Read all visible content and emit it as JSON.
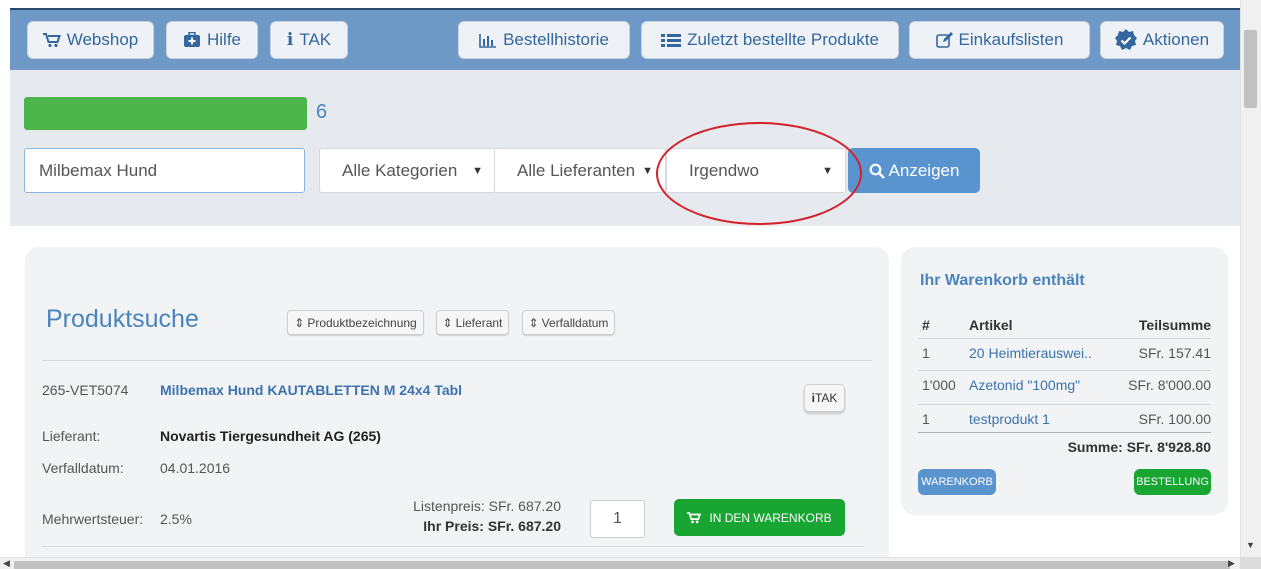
{
  "nav": {
    "webshop": "Webshop",
    "hilfe": "Hilfe",
    "tak": "TAK",
    "bestellhistorie": "Bestellhistorie",
    "zuletzt": "Zuletzt bestellte Produkte",
    "einkaufslisten": "Einkaufslisten",
    "aktionen": "Aktionen"
  },
  "progress": {
    "count": "6",
    "fill_fraction": 1.0,
    "color": "#4cb54c"
  },
  "search": {
    "query": "Milbemax Hund",
    "category": "Alle Kategorien",
    "supplier": "Alle Lieferanten",
    "location": "Irgendwo",
    "button": "Anzeigen"
  },
  "results": {
    "title": "Produktsuche",
    "sort": {
      "name": "Produktbezeichnung",
      "supplier": "Lieferant",
      "expiry": "Verfalldatum"
    },
    "product": {
      "code": "265-VET5074",
      "name": "Milbemax Hund KAUTABLETTEN M 24x4 Tabl",
      "tak": "TAK",
      "supplier_label": "Lieferant:",
      "supplier": "Novartis Tiergesundheit AG (265)",
      "expiry_label": "Verfalldatum:",
      "expiry": "04.01.2016",
      "vat_label": "Mehrwertsteuer:",
      "vat": "2.5%",
      "list_price": "Listenpreis: SFr. 687.20",
      "your_price": "Ihr Preis: SFr. 687.20",
      "quantity": "1",
      "add_to_cart": "IN DEN WARENKORB"
    }
  },
  "cart": {
    "title": "Ihr Warenkorb enthält",
    "headers": {
      "num": "#",
      "article": "Artikel",
      "subtotal": "Teilsumme"
    },
    "rows": [
      {
        "qty": "1",
        "article": "20 Heimtierauswei..",
        "subtotal": "SFr. 157.41"
      },
      {
        "qty": "1'000",
        "article": "Azetonid \"100mg\"",
        "subtotal": "SFr. 8'000.00"
      },
      {
        "qty": "1",
        "article": "testprodukt 1",
        "subtotal": "SFr. 100.00"
      }
    ],
    "total": "Summe: SFr. 8'928.80",
    "cart_button": "WARENKORB",
    "order_button": "BESTELLUNG"
  },
  "colors": {
    "navbar": "#6e98c6",
    "accent_blue": "#4a84bd",
    "green": "#18a532",
    "annotation_red": "#d4202a"
  }
}
